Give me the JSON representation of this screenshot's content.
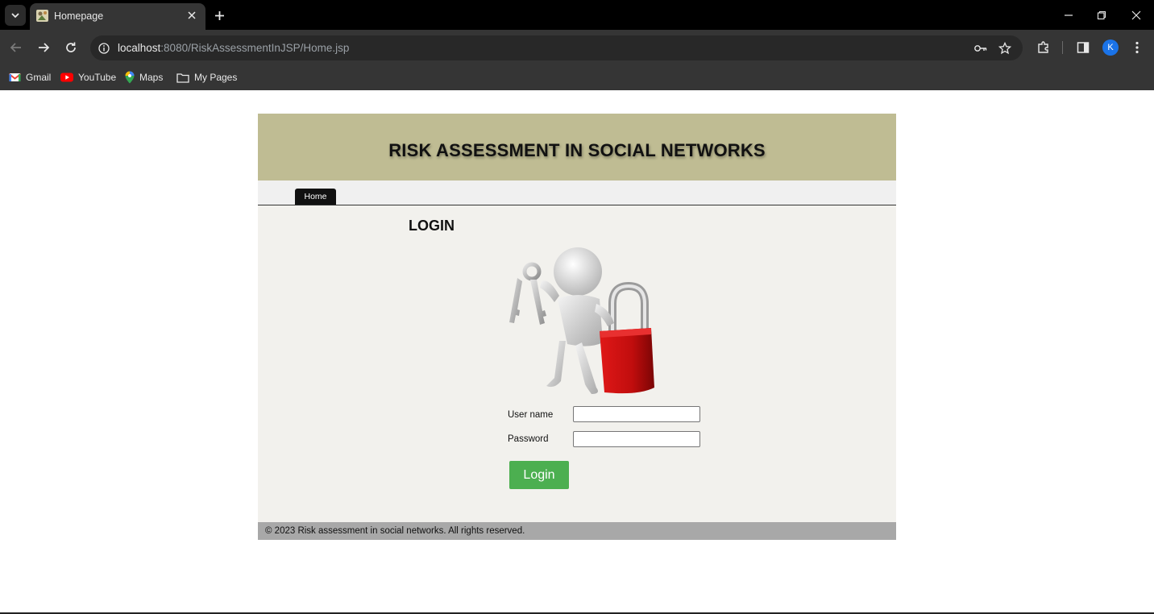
{
  "browser": {
    "tab": {
      "title": "Homepage"
    },
    "url": {
      "host": "localhost",
      "path": ":8080/RiskAssessmentInJSP/Home.jsp"
    },
    "avatar_letter": "K",
    "bookmarks": [
      {
        "label": "Gmail",
        "icon": "gmail-icon"
      },
      {
        "label": "YouTube",
        "icon": "youtube-icon"
      },
      {
        "label": "Maps",
        "icon": "maps-icon"
      },
      {
        "label": "My Pages",
        "icon": "folder-icon"
      }
    ]
  },
  "site": {
    "title": "RISK ASSESSMENT IN SOCIAL NETWORKS",
    "nav": {
      "home": "Home"
    },
    "login": {
      "heading": "LOGIN",
      "username_label": "User name",
      "password_label": "Password",
      "username_value": "",
      "password_value": "",
      "button": "Login"
    },
    "footer": "© 2023 Risk assessment in social networks. All rights reserved."
  },
  "colors": {
    "header_bg": "#bfbc93",
    "login_button": "#4caf50",
    "footer_bg": "#a8a8a8",
    "content_bg": "#f2f1ed"
  }
}
